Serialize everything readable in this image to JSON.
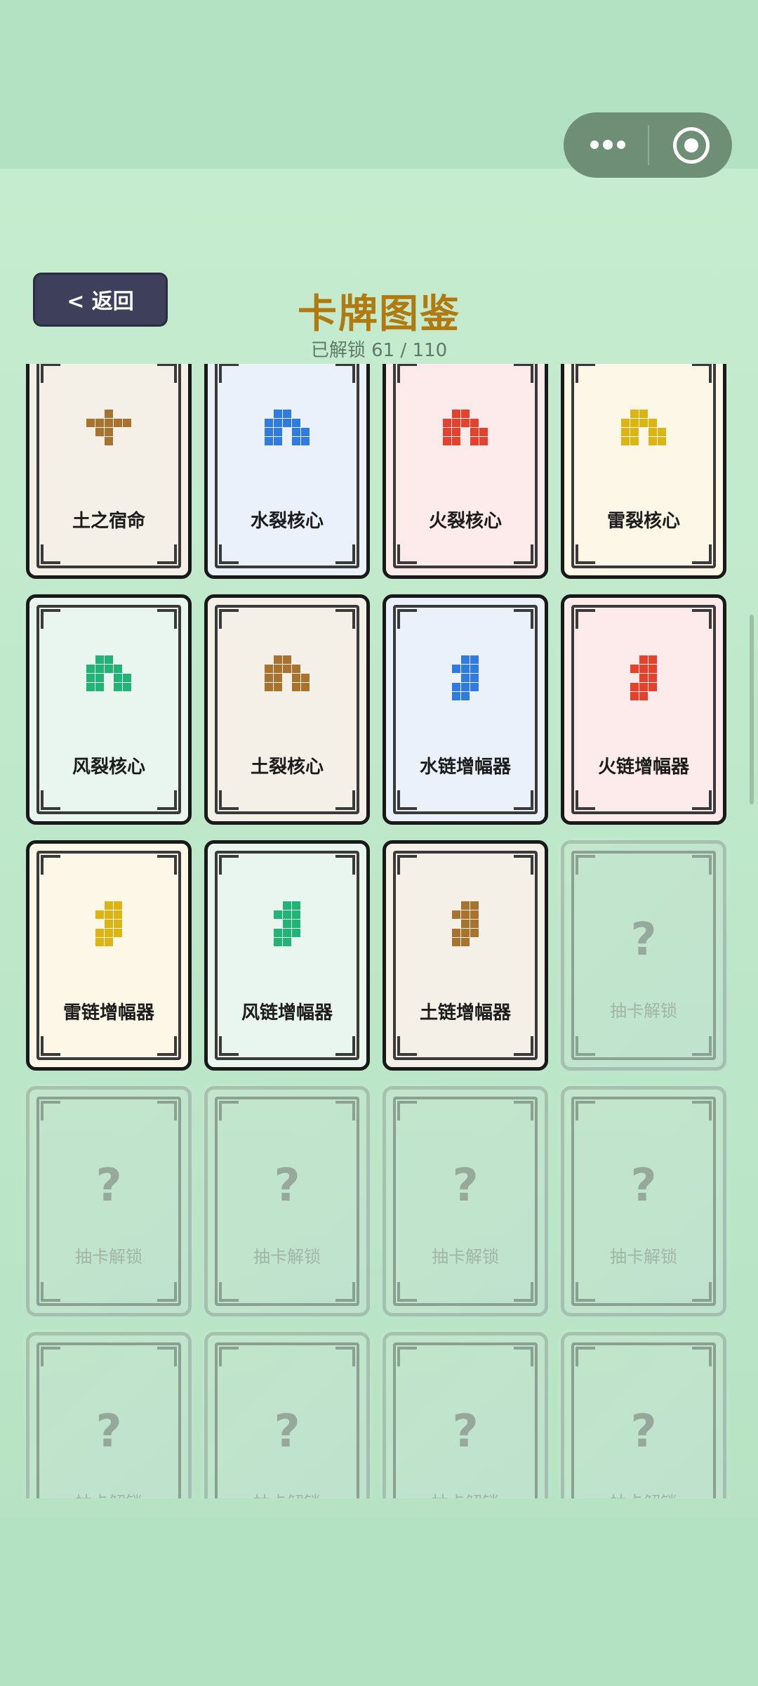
{
  "header": {
    "back_label": "< 返回",
    "title": "卡牌图鉴",
    "progress_text": "已解锁 61 / 110"
  },
  "colors": {
    "water": "#2f7be0",
    "fire": "#e5422d",
    "thunder": "#dcb414",
    "wind": "#22b377",
    "earth": "#a8732e"
  },
  "element_bg": {
    "water": "#eaf1fb",
    "fire": "#fdeaea",
    "thunder": "#fcf7e7",
    "wind": "#e8f6ef",
    "earth": "#f4efe7"
  },
  "locked_label": "抽卡解锁",
  "locked_symbol": "?",
  "cards": [
    {
      "name": "土之宿命",
      "element": "earth",
      "icon": "destiny-icon",
      "unlocked": true
    },
    {
      "name": "水裂核心",
      "element": "water",
      "icon": "split-core-icon",
      "unlocked": true
    },
    {
      "name": "火裂核心",
      "element": "fire",
      "icon": "split-core-icon",
      "unlocked": true
    },
    {
      "name": "雷裂核心",
      "element": "thunder",
      "icon": "split-core-icon",
      "unlocked": true
    },
    {
      "name": "风裂核心",
      "element": "wind",
      "icon": "split-core-icon",
      "unlocked": true
    },
    {
      "name": "土裂核心",
      "element": "earth",
      "icon": "split-core-icon",
      "unlocked": true
    },
    {
      "name": "水链增幅器",
      "element": "water",
      "icon": "chain-amplifier-icon",
      "unlocked": true
    },
    {
      "name": "火链增幅器",
      "element": "fire",
      "icon": "chain-amplifier-icon",
      "unlocked": true
    },
    {
      "name": "雷链增幅器",
      "element": "thunder",
      "icon": "chain-amplifier-icon",
      "unlocked": true
    },
    {
      "name": "风链增幅器",
      "element": "wind",
      "icon": "chain-amplifier-icon",
      "unlocked": true
    },
    {
      "name": "土链增幅器",
      "element": "earth",
      "icon": "chain-amplifier-icon",
      "unlocked": true
    },
    {
      "unlocked": false
    },
    {
      "unlocked": false
    },
    {
      "unlocked": false
    },
    {
      "unlocked": false
    },
    {
      "unlocked": false
    },
    {
      "unlocked": false
    },
    {
      "unlocked": false
    },
    {
      "unlocked": false
    },
    {
      "unlocked": false
    }
  ]
}
